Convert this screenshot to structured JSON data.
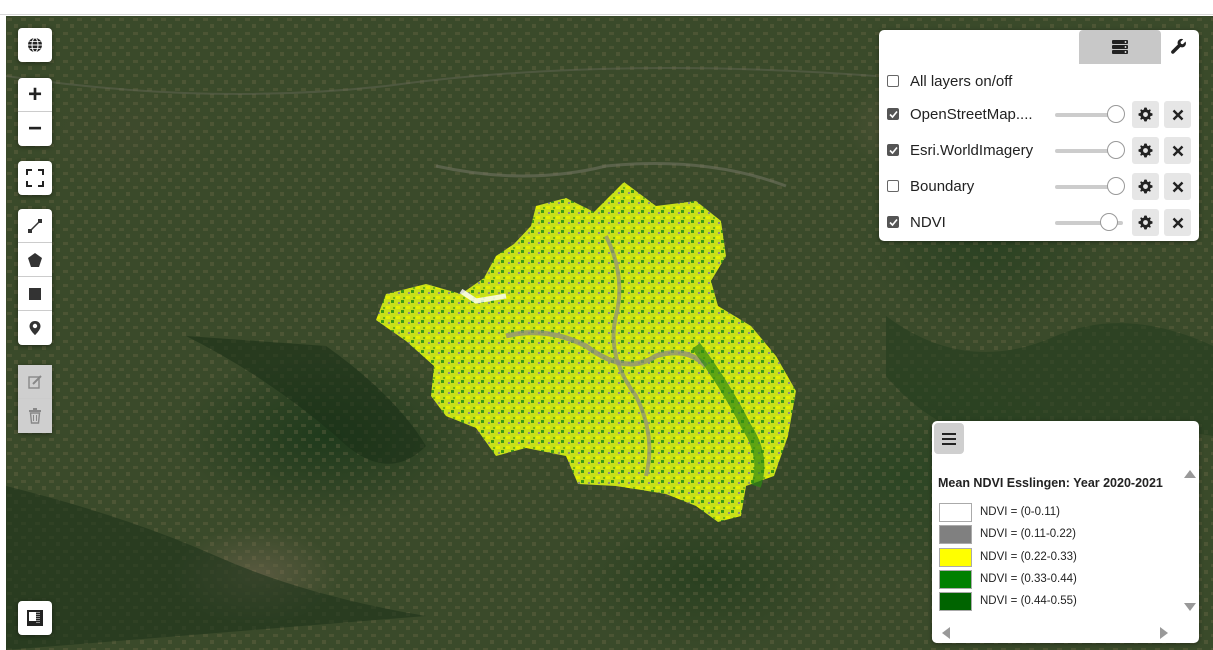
{
  "map": {
    "description_icons": {
      "globe": "globe-icon",
      "zoom_in": "plus-icon",
      "zoom_out": "minus-icon",
      "fullscreen": "fullscreen-icon",
      "draw_line": "polyline-icon",
      "draw_polygon": "polygon-icon",
      "draw_rectangle": "rectangle-icon",
      "draw_marker": "marker-icon",
      "edit": "edit-icon",
      "delete": "trash-icon",
      "minimap": "minimap-icon"
    },
    "zoom_in_label": "+",
    "zoom_out_label": "−"
  },
  "layer_panel": {
    "tabs": [
      {
        "name": "layers",
        "icon": "layers-icon",
        "active": true
      },
      {
        "name": "tools",
        "icon": "wrench-icon",
        "active": false
      }
    ],
    "all_layers_label": "All layers on/off",
    "all_layers_checked": false,
    "layers": [
      {
        "label": "OpenStreetMap....",
        "checked": true,
        "opacity": 1.0
      },
      {
        "label": "Esri.WorldImagery",
        "checked": true,
        "opacity": 1.0
      },
      {
        "label": "Boundary",
        "checked": false,
        "opacity": 1.0
      },
      {
        "label": "NDVI",
        "checked": true,
        "opacity": 0.85
      }
    ]
  },
  "legend": {
    "title": "Mean NDVI Esslingen: Year 2020-2021",
    "items": [
      {
        "label": "NDVI = (0-0.11)",
        "color": "#ffffff"
      },
      {
        "label": "NDVI = (0.11-0.22)",
        "color": "#808080"
      },
      {
        "label": "NDVI = (0.22-0.33)",
        "color": "#ffff00"
      },
      {
        "label": "NDVI = (0.33-0.44)",
        "color": "#008000"
      },
      {
        "label": "NDVI = (0.44-0.55)",
        "color": "#006400"
      }
    ]
  },
  "colors": {
    "ndvi_low": "#ffff00",
    "ndvi_mid": "#9acd32",
    "ndvi_high": "#228b22",
    "urban": "#8a8a8a",
    "forest": "#1f3a1c"
  }
}
